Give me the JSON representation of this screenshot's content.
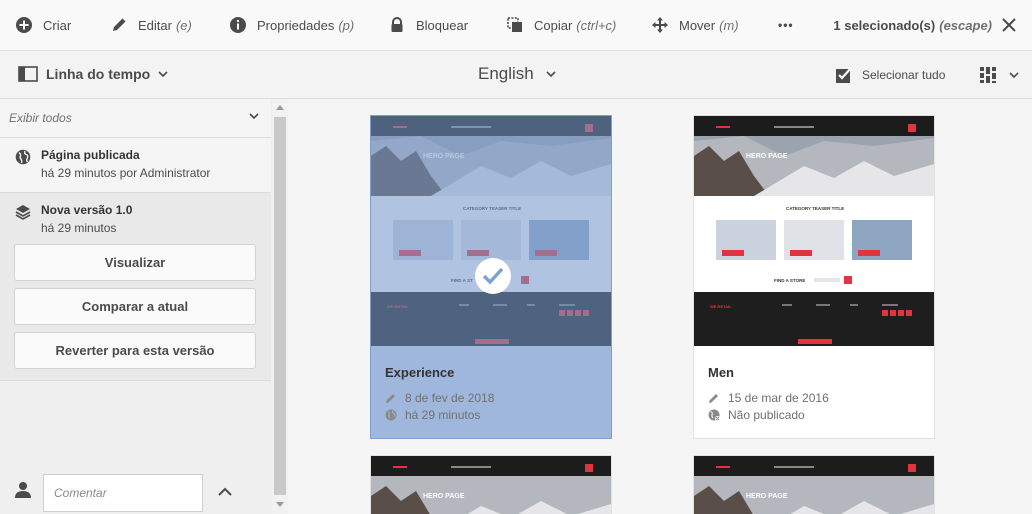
{
  "actionbar": {
    "create": "Criar",
    "edit": "Editar",
    "edit_hint": "(e)",
    "properties": "Propriedades",
    "properties_hint": "(p)",
    "lock": "Bloquear",
    "copy": "Copiar",
    "copy_hint": "(ctrl+c)",
    "move": "Mover",
    "move_hint": "(m)",
    "more": "•••",
    "selection": "1 selecionado(s)",
    "selection_hint": "(escape)"
  },
  "toolbar": {
    "rail_label": "Linha do tempo",
    "language": "English",
    "select_all": "Selecionar tudo"
  },
  "rail": {
    "filter": "Exibir todos",
    "entries": [
      {
        "title": "Página publicada",
        "subtitle": "há 29 minutos por Administrator"
      },
      {
        "title": "Nova versão 1.0",
        "subtitle": "há 29 minutos"
      }
    ],
    "buttons": {
      "preview": "Visualizar",
      "compare": "Comparar a atual",
      "revert": "Reverter para esta versão"
    },
    "comment_placeholder": "Comentar"
  },
  "cards": [
    {
      "title": "Experience",
      "modified": "8 de fev de 2018",
      "published": "há 29 minutos",
      "selected": true
    },
    {
      "title": "Men",
      "modified": "15 de mar de 2016",
      "published": "Não publicado",
      "selected": false
    }
  ],
  "thumbnail": {
    "hero": "HERO PAGE",
    "teaser": "CATEGORY TEASER TITLE",
    "store": "FIND A STORE",
    "store_short": "FIND A ST",
    "brand": "WE.RETAIL"
  },
  "colors": {
    "accent_selected": "#9fb7dc",
    "brand_red": "#e0353f",
    "footer_dark": "#1e1e1e"
  }
}
